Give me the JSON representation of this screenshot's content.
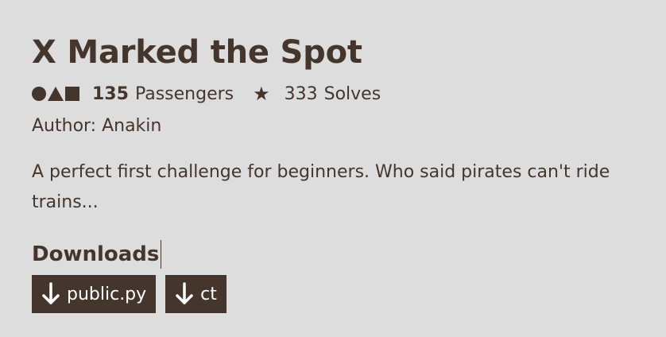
{
  "challenge": {
    "title": "X Marked the Spot",
    "passengers_count": "135",
    "passengers_label": "Passengers",
    "solves_count": "333",
    "solves_label": "Solves",
    "author": "Author: Anakin",
    "description": "A perfect first challenge for beginners. Who said pirates can't ride trains..."
  },
  "downloads": {
    "heading": "Downloads",
    "files": [
      {
        "label": "public.py",
        "icon": "download-arrow-icon"
      },
      {
        "label": "ct",
        "icon": "download-arrow-icon"
      }
    ]
  },
  "icons": {
    "shapes": "circle-triangle-square-icon",
    "star": "star-icon"
  },
  "colors": {
    "background": "#dddddd",
    "text": "#45362d",
    "button_bg": "#45362d",
    "button_text": "#ffffff"
  }
}
